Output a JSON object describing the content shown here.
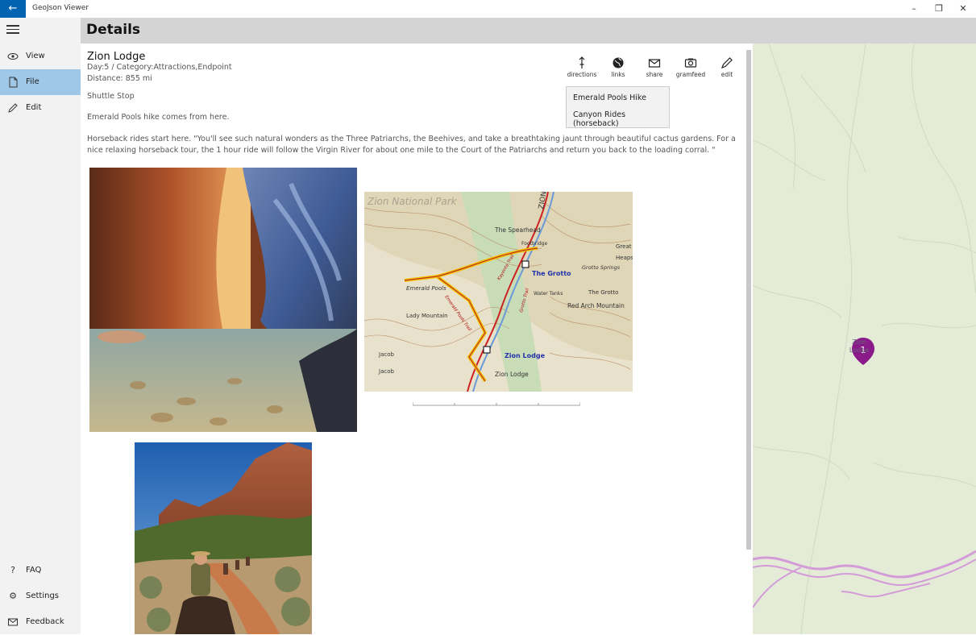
{
  "app": {
    "title": "GeoJson Viewer",
    "back_icon": "back-arrow-icon"
  },
  "window_controls": {
    "minimize": "–",
    "restore": "❐",
    "close": "✕"
  },
  "nav": {
    "items": [
      {
        "label": "View",
        "icon": "eye-icon"
      },
      {
        "label": "File",
        "icon": "file-icon",
        "selected": true
      },
      {
        "label": "Edit",
        "icon": "pencil-icon"
      }
    ],
    "bottom_items": [
      {
        "label": "FAQ",
        "icon": "question-icon"
      },
      {
        "label": "Settings",
        "icon": "gear-icon"
      },
      {
        "label": "Feedback",
        "icon": "mail-icon"
      }
    ]
  },
  "header": {
    "title": "Details"
  },
  "feature": {
    "name": "Zion Lodge",
    "day_category": "Day:5 / Category:Attractions,Endpoint",
    "distance": "Distance: 855 mi",
    "paragraph1": "Shuttle Stop",
    "paragraph2": "Emerald Pools hike comes from here.",
    "paragraph3": "Horseback rides start here. \"You'll see such natural wonders as the Three Patriarchs, the Beehives, and take a breathtaking jaunt through beautiful cactus gardens. For a nice relaxing horseback tour, the 1 hour ride will follow the Virgin River for about one mile to the Court of the Patriarchs and return you back to the loading corral. \""
  },
  "toolbar": {
    "directions": "directions",
    "links": "links",
    "share": "share",
    "gramfeed": "gramfeed",
    "edit": "edit"
  },
  "links_menu": {
    "items": [
      "Emerald Pools Hike",
      "Canyon Rides (horseback)"
    ]
  },
  "topo_map": {
    "title": "Zion National Park",
    "labels": [
      "ZION",
      "The Spearhead",
      "Footbridge",
      "The Grotto",
      "Grotto Springs",
      "The Grotto",
      "Water Tanks",
      "Red Arch Mountain",
      "Emerald Pools",
      "Lady Mountain",
      "Jacob",
      "Jacob",
      "Zion Lodge",
      "Zion Lodge",
      "Emerald Pools Trail",
      "Kayenta Trail",
      "Grotto Trail",
      "Great",
      "Heaps"
    ]
  },
  "map": {
    "pin_number": "1",
    "pin_label": "Zion Lodge",
    "pin_color": "#8b1a8b"
  },
  "colors": {
    "accent": "#0063b1",
    "nav_selected": "#9fc8e8",
    "header_bg": "#d4d4d4",
    "nav_bg": "#f2f2f2",
    "map_bg": "#e4ecd8"
  }
}
